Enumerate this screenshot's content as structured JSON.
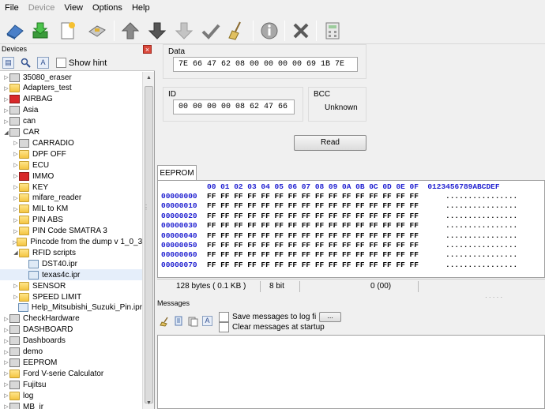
{
  "menu": {
    "items": [
      {
        "label": "File",
        "enabled": true
      },
      {
        "label": "Device",
        "enabled": false
      },
      {
        "label": "View",
        "enabled": true
      },
      {
        "label": "Options",
        "enabled": true
      },
      {
        "label": "Help",
        "enabled": true
      }
    ]
  },
  "toolbar": {
    "icons": [
      "eraser-icon",
      "download-icon",
      "new-file-icon",
      "device-icon",
      "up-arrow-icon",
      "down-arrow-icon",
      "down-arrow-disabled-icon",
      "check-icon",
      "broom-icon",
      "info-icon",
      "close-icon",
      "calculator-icon"
    ]
  },
  "devices": {
    "title": "Devices",
    "show_hint_label": "Show hint",
    "tree": [
      {
        "label": "35080_eraser",
        "icon": "grayico",
        "expander": "▷",
        "indent": 0
      },
      {
        "label": "Adapters_test",
        "icon": "folder",
        "expander": "▷",
        "indent": 0
      },
      {
        "label": "AIRBAG",
        "icon": "redico",
        "expander": "▷",
        "indent": 0
      },
      {
        "label": "Asia",
        "icon": "grayico",
        "expander": "▷",
        "indent": 0
      },
      {
        "label": "can",
        "icon": "grayico",
        "expander": "▷",
        "indent": 0
      },
      {
        "label": "CAR",
        "icon": "grayico",
        "expander": "◢",
        "indent": 0
      },
      {
        "label": "CARRADIO",
        "icon": "grayico",
        "expander": "▷",
        "indent": 1
      },
      {
        "label": "DPF OFF",
        "icon": "folder",
        "expander": "▷",
        "indent": 1
      },
      {
        "label": "ECU",
        "icon": "folder",
        "expander": "▷",
        "indent": 1
      },
      {
        "label": "IMMO",
        "icon": "redico",
        "expander": "▷",
        "indent": 1
      },
      {
        "label": "KEY",
        "icon": "folder",
        "expander": "▷",
        "indent": 1
      },
      {
        "label": "mifare_reader",
        "icon": "folder",
        "expander": "▷",
        "indent": 1
      },
      {
        "label": "MIL to KM",
        "icon": "folder",
        "expander": "▷",
        "indent": 1
      },
      {
        "label": "PIN ABS",
        "icon": "folder",
        "expander": "▷",
        "indent": 1
      },
      {
        "label": "PIN Code SMATRA 3",
        "icon": "folder",
        "expander": "▷",
        "indent": 1
      },
      {
        "label": "Pincode from the dump v 1_0_3",
        "icon": "folder",
        "expander": "▷",
        "indent": 1
      },
      {
        "label": "RFID scripts",
        "icon": "folder",
        "expander": "◢",
        "indent": 1
      },
      {
        "label": "DST40.ipr",
        "icon": "file",
        "expander": "",
        "indent": 2
      },
      {
        "label": "texas4c.ipr",
        "icon": "file",
        "expander": "",
        "indent": 2,
        "selected": true
      },
      {
        "label": "SENSOR",
        "icon": "folder",
        "expander": "▷",
        "indent": 1
      },
      {
        "label": "SPEED LIMIT",
        "icon": "folder",
        "expander": "▷",
        "indent": 1
      },
      {
        "label": "Help_Mitsubishi_Suzuki_Pin.ipr",
        "icon": "file",
        "expander": "",
        "indent": 1
      },
      {
        "label": "CheckHardware",
        "icon": "grayico",
        "expander": "▷",
        "indent": 0
      },
      {
        "label": "DASHBOARD",
        "icon": "grayico",
        "expander": "▷",
        "indent": 0
      },
      {
        "label": "Dashboards",
        "icon": "grayico",
        "expander": "▷",
        "indent": 0
      },
      {
        "label": "demo",
        "icon": "grayico",
        "expander": "▷",
        "indent": 0
      },
      {
        "label": "EEPROM",
        "icon": "grayico",
        "expander": "▷",
        "indent": 0
      },
      {
        "label": "Ford V-serie Calculator",
        "icon": "folder",
        "expander": "▷",
        "indent": 0
      },
      {
        "label": "Fujitsu",
        "icon": "grayico",
        "expander": "▷",
        "indent": 0
      },
      {
        "label": "log",
        "icon": "folder",
        "expander": "▷",
        "indent": 0
      },
      {
        "label": "MB_ir",
        "icon": "grayico",
        "expander": "▷",
        "indent": 0
      }
    ]
  },
  "data_panel": {
    "data_label": "Data",
    "data_value": "7E 66 47 62 08 00 00 00 00 69 1B 7E",
    "id_label": "ID",
    "id_value": "00 00 00 00 08 62 47 66",
    "bcc_label": "BCC",
    "bcc_value": "Unknown",
    "read_button": "Read"
  },
  "eeprom": {
    "tab_label": "EEPROM",
    "header": "00 01 02 03 04 05 06 07 08 09 0A 0B 0C 0D 0E 0F  0123456789ABCDEF",
    "rows": [
      {
        "addr": "00000000",
        "bytes": "FF FF FF FF FF FF FF FF FF FF FF FF FF FF FF FF",
        "ascii": "................"
      },
      {
        "addr": "00000010",
        "bytes": "FF FF FF FF FF FF FF FF FF FF FF FF FF FF FF FF",
        "ascii": "................"
      },
      {
        "addr": "00000020",
        "bytes": "FF FF FF FF FF FF FF FF FF FF FF FF FF FF FF FF",
        "ascii": "................"
      },
      {
        "addr": "00000030",
        "bytes": "FF FF FF FF FF FF FF FF FF FF FF FF FF FF FF FF",
        "ascii": "................"
      },
      {
        "addr": "00000040",
        "bytes": "FF FF FF FF FF FF FF FF FF FF FF FF FF FF FF FF",
        "ascii": "................"
      },
      {
        "addr": "00000050",
        "bytes": "FF FF FF FF FF FF FF FF FF FF FF FF FF FF FF FF",
        "ascii": "................"
      },
      {
        "addr": "00000060",
        "bytes": "FF FF FF FF FF FF FF FF FF FF FF FF FF FF FF FF",
        "ascii": "................"
      },
      {
        "addr": "00000070",
        "bytes": "FF FF FF FF FF FF FF FF FF FF FF FF FF FF FF FF",
        "ascii": "................"
      }
    ],
    "status_size": "128 bytes ( 0.1 KB )",
    "status_bits": "8 bit",
    "status_pos": "0 (00)"
  },
  "messages": {
    "title": "Messages",
    "save_label": "Save messages to log fi",
    "browse_label": "...",
    "clear_label": "Clear messages at startup"
  }
}
